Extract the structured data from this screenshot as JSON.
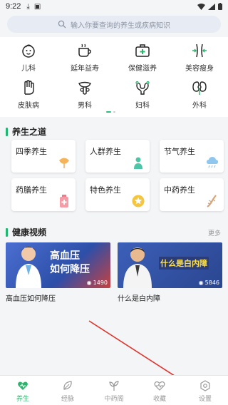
{
  "status": {
    "time": "9:22"
  },
  "search": {
    "placeholder": "输入你要查询的养生或疾病知识"
  },
  "categories": [
    {
      "label": "儿科",
      "icon": "child-face-icon"
    },
    {
      "label": "延年益寿",
      "icon": "teacup-icon"
    },
    {
      "label": "保健滋养",
      "icon": "first-aid-kit-icon"
    },
    {
      "label": "美容瘦身",
      "icon": "slim-body-icon"
    },
    {
      "label": "皮肤病",
      "icon": "hand-icon"
    },
    {
      "label": "男科",
      "icon": "male-organ-icon"
    },
    {
      "label": "妇科",
      "icon": "uterus-icon"
    },
    {
      "label": "外科",
      "icon": "kidney-icon"
    }
  ],
  "section1": {
    "title": "养生之道"
  },
  "wellness_cards": [
    {
      "label": "四季养生",
      "icon": "ginkgo-leaf-icon"
    },
    {
      "label": "人群养生",
      "icon": "person-icon"
    },
    {
      "label": "节气养生",
      "icon": "rain-cloud-icon"
    },
    {
      "label": "药膳养生",
      "icon": "medicine-bottle-icon"
    },
    {
      "label": "特色养生",
      "icon": "star-badge-icon"
    },
    {
      "label": "中药养生",
      "icon": "herb-root-icon"
    }
  ],
  "section2": {
    "title": "健康视频",
    "more": "更多"
  },
  "videos": [
    {
      "title": "高血压如何降压",
      "thumb_line1": "高血压",
      "thumb_line2": "如何降压",
      "views": "1490"
    },
    {
      "title": "什么是白内障",
      "thumb_line1": "什么是白内障",
      "views": "5846"
    }
  ],
  "tabs": [
    {
      "label": "养生",
      "icon": "heart-icon",
      "active": true
    },
    {
      "label": "经脉",
      "icon": "leaf-icon",
      "active": false
    },
    {
      "label": "中药阁",
      "icon": "herb-plant-icon",
      "active": false
    },
    {
      "label": "收藏",
      "icon": "pulse-heart-icon",
      "active": false
    },
    {
      "label": "设置",
      "icon": "gear-icon",
      "active": false
    }
  ],
  "colors": {
    "accent": "#2cb46d",
    "search_bg": "#e7ebf3",
    "video_bg": "#3f5fb0"
  }
}
